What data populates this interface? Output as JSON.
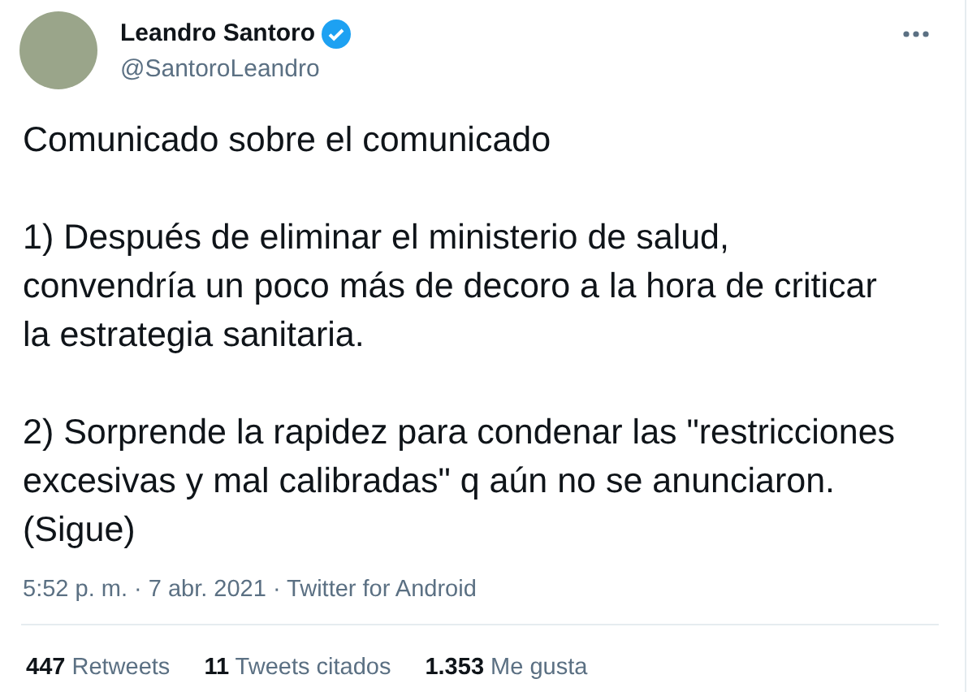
{
  "author": {
    "name": "Leandro Santoro",
    "verified": true,
    "handle": "@SantoroLeandro"
  },
  "paragraphs": [
    {
      "lines": [
        "Comunicado sobre el comunicado"
      ]
    },
    {
      "lines": [
        "1) Después de eliminar el ministerio de salud,",
        "convendría un poco más de decoro a la hora de criticar",
        "la estrategia sanitaria."
      ]
    },
    {
      "lines": [
        "2) Sorprende la rapidez para condenar las \"restricciones",
        "excesivas y mal calibradas\" q aún no se anunciaron.",
        "(Sigue)"
      ]
    }
  ],
  "meta": {
    "timestamp": "5:52 p. m. · 7 abr. 2021 · Twitter for Android"
  },
  "stats": [
    {
      "text": "**447** Retweets"
    },
    {
      "text": "**11** Tweets citados"
    },
    {
      "text": "**1.353** Me gusta"
    }
  ]
}
